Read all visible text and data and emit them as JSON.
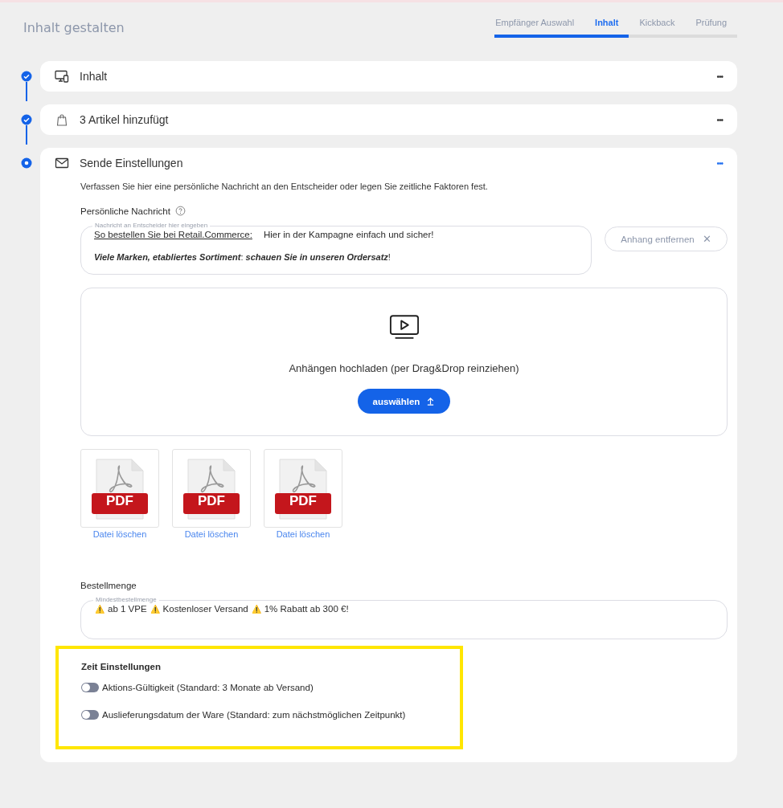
{
  "page_title": "Inhalt gestalten",
  "tabs": [
    {
      "label": "Empfänger Auswahl",
      "selected": false
    },
    {
      "label": "Inhalt",
      "selected": true
    },
    {
      "label": "Kickback",
      "selected": false
    },
    {
      "label": "Prüfung",
      "selected": false
    }
  ],
  "steps": [
    {
      "kind": "screens",
      "title": "Inhalt",
      "done": true,
      "expanded": false,
      "menu": "•••"
    },
    {
      "kind": "bag",
      "title": "3 Artikel hinzufügt",
      "done": true,
      "expanded": false,
      "menu": "•••"
    },
    {
      "kind": "mail",
      "title": "Sende Einstellungen",
      "done": false,
      "expanded": true,
      "menu": "•••"
    }
  ],
  "send_settings": {
    "intro": "Verfassen Sie hier eine persönliche Nachricht an den Entscheider oder legen Sie zeitliche Faktoren fest.",
    "message": {
      "label": "Persönliche Nachricht",
      "placeholder": "Nachricht an Entscheider hier eingeben",
      "link_text": "So bestellen Sie bei Retail.Commerce:",
      "line_1": "Hier in der Kampagne einfach und sicher!",
      "line_2": "**Viele Marken, etabliertes Sortiment**: **schauen Sie in unseren Ordersatz**!"
    },
    "remove_attachment": {
      "label": "Anhang entfernen",
      "icon": "✕"
    },
    "upload": {
      "text": "Anhängen hochladen (per Drag&Drop reinziehen)",
      "button": "auswählen"
    },
    "files": [
      {
        "kind": "pdf",
        "badge": "PDF",
        "action": "Datei löschen"
      },
      {
        "kind": "pdf",
        "badge": "PDF",
        "action": "Datei löschen"
      },
      {
        "kind": "pdf",
        "badge": "PDF",
        "action": "Datei löschen"
      }
    ],
    "order": {
      "label": "Bestellmenge",
      "placeholder": "Mindestbestellmenge",
      "items": [
        "ab 1 VPE",
        "Kostenloser Versand",
        "1% Rabatt ab 300 €!"
      ],
      "warn": "⚠️"
    },
    "time": {
      "title": "Zeit Einstellungen",
      "highlighted": true,
      "options": [
        {
          "label": "Aktions-Gültigkeit (Standard: 3 Monate ab Versand)",
          "on": false
        },
        {
          "label": "Auslieferungsdatum der Ware (Standard: zum nächstmöglichen Zeitpunkt)",
          "on": false
        }
      ]
    }
  }
}
